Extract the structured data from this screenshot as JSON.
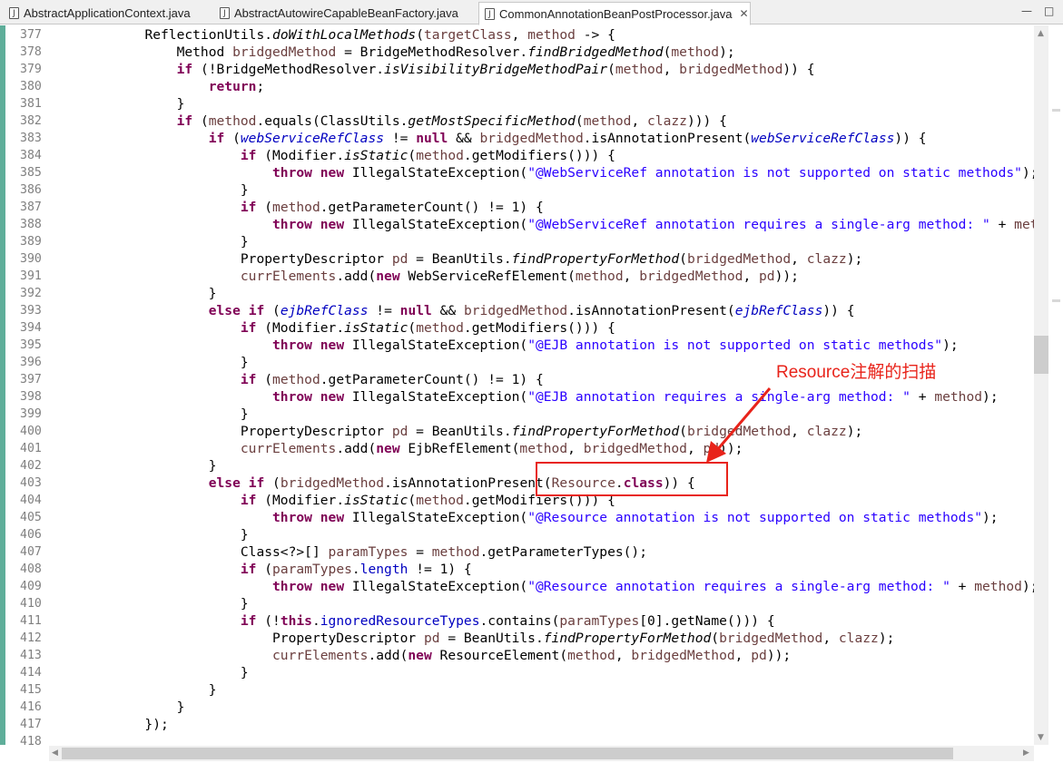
{
  "tabs": [
    {
      "label": "AbstractApplicationContext.java",
      "active": false,
      "icon": "java-file-icon"
    },
    {
      "label": "AbstractAutowireCapableBeanFactory.java",
      "active": false,
      "icon": "java-file-icon"
    },
    {
      "label": "CommonAnnotationBeanPostProcessor.java",
      "active": true,
      "icon": "java-file-icon",
      "close": "✕"
    }
  ],
  "window_controls": {
    "minimize": "—",
    "maximize": "□"
  },
  "annotation": {
    "text": "Resource注解的扫描",
    "color": "#e8231a"
  },
  "colors": {
    "keyword": "#7f0055",
    "field": "#0000c0",
    "string": "#2a00ff",
    "local_var": "#6a3e3e",
    "line_number": "#808080",
    "annotation": "#e8231a"
  },
  "lines": [
    {
      "n": "377",
      "segs": [
        [
          "            ",
          ""
        ],
        [
          "ReflectionUtils.",
          ""
        ],
        [
          "doWithLocalMethods",
          "mi"
        ],
        [
          "(",
          ""
        ],
        [
          "targetClass",
          "var"
        ],
        [
          ", ",
          ""
        ],
        [
          "method",
          "var"
        ],
        [
          " -> {",
          ""
        ]
      ]
    },
    {
      "n": "378",
      "segs": [
        [
          "                Method ",
          ""
        ],
        [
          "bridgedMethod",
          "var"
        ],
        [
          " = BridgeMethodResolver.",
          ""
        ],
        [
          "findBridgedMethod",
          "mi"
        ],
        [
          "(",
          ""
        ],
        [
          "method",
          "var"
        ],
        [
          ");",
          ""
        ]
      ]
    },
    {
      "n": "379",
      "segs": [
        [
          "                ",
          ""
        ],
        [
          "if",
          "kw"
        ],
        [
          " (!BridgeMethodResolver.",
          ""
        ],
        [
          "isVisibilityBridgeMethodPair",
          "mi"
        ],
        [
          "(",
          ""
        ],
        [
          "method",
          "var"
        ],
        [
          ", ",
          ""
        ],
        [
          "bridgedMethod",
          "var"
        ],
        [
          ")) {",
          ""
        ]
      ]
    },
    {
      "n": "380",
      "segs": [
        [
          "                    ",
          ""
        ],
        [
          "return",
          "kw"
        ],
        [
          ";",
          ""
        ]
      ]
    },
    {
      "n": "381",
      "segs": [
        [
          "                }",
          ""
        ]
      ]
    },
    {
      "n": "382",
      "segs": [
        [
          "                ",
          ""
        ],
        [
          "if",
          "kw"
        ],
        [
          " (",
          ""
        ],
        [
          "method",
          "var"
        ],
        [
          ".equals(ClassUtils.",
          ""
        ],
        [
          "getMostSpecificMethod",
          "mi"
        ],
        [
          "(",
          ""
        ],
        [
          "method",
          "var"
        ],
        [
          ", ",
          ""
        ],
        [
          "clazz",
          "var"
        ],
        [
          "))) {",
          ""
        ]
      ]
    },
    {
      "n": "383",
      "segs": [
        [
          "                    ",
          ""
        ],
        [
          "if",
          "kw"
        ],
        [
          " (",
          ""
        ],
        [
          "webServiceRefClass",
          "fldi"
        ],
        [
          " != ",
          ""
        ],
        [
          "null",
          "kw"
        ],
        [
          " && ",
          ""
        ],
        [
          "bridgedMethod",
          "var"
        ],
        [
          ".isAnnotationPresent(",
          ""
        ],
        [
          "webServiceRefClass",
          "fldi"
        ],
        [
          ")) {",
          ""
        ]
      ]
    },
    {
      "n": "384",
      "segs": [
        [
          "                        ",
          ""
        ],
        [
          "if",
          "kw"
        ],
        [
          " (Modifier.",
          ""
        ],
        [
          "isStatic",
          "mi"
        ],
        [
          "(",
          ""
        ],
        [
          "method",
          "var"
        ],
        [
          ".getModifiers())) {",
          ""
        ]
      ]
    },
    {
      "n": "385",
      "segs": [
        [
          "                            ",
          ""
        ],
        [
          "throw",
          "kw"
        ],
        [
          " ",
          ""
        ],
        [
          "new",
          "kw"
        ],
        [
          " IllegalStateException(",
          ""
        ],
        [
          "\"@WebServiceRef annotation is not supported on static methods\"",
          "str"
        ],
        [
          ");",
          ""
        ]
      ]
    },
    {
      "n": "386",
      "segs": [
        [
          "                        }",
          ""
        ]
      ]
    },
    {
      "n": "387",
      "segs": [
        [
          "                        ",
          ""
        ],
        [
          "if",
          "kw"
        ],
        [
          " (",
          ""
        ],
        [
          "method",
          "var"
        ],
        [
          ".getParameterCount() != 1) {",
          ""
        ]
      ]
    },
    {
      "n": "388",
      "segs": [
        [
          "                            ",
          ""
        ],
        [
          "throw",
          "kw"
        ],
        [
          " ",
          ""
        ],
        [
          "new",
          "kw"
        ],
        [
          " IllegalStateException(",
          ""
        ],
        [
          "\"@WebServiceRef annotation requires a single-arg method: \"",
          "str"
        ],
        [
          " + ",
          ""
        ],
        [
          "method",
          "var"
        ],
        [
          ");",
          ""
        ]
      ]
    },
    {
      "n": "389",
      "segs": [
        [
          "                        }",
          ""
        ]
      ]
    },
    {
      "n": "390",
      "segs": [
        [
          "                        PropertyDescriptor ",
          ""
        ],
        [
          "pd",
          "var"
        ],
        [
          " = BeanUtils.",
          ""
        ],
        [
          "findPropertyForMethod",
          "mi"
        ],
        [
          "(",
          ""
        ],
        [
          "bridgedMethod",
          "var"
        ],
        [
          ", ",
          ""
        ],
        [
          "clazz",
          "var"
        ],
        [
          ");",
          ""
        ]
      ]
    },
    {
      "n": "391",
      "segs": [
        [
          "                        ",
          ""
        ],
        [
          "currElements",
          "var"
        ],
        [
          ".add(",
          ""
        ],
        [
          "new",
          "kw"
        ],
        [
          " WebServiceRefElement(",
          ""
        ],
        [
          "method",
          "var"
        ],
        [
          ", ",
          ""
        ],
        [
          "bridgedMethod",
          "var"
        ],
        [
          ", ",
          ""
        ],
        [
          "pd",
          "var"
        ],
        [
          "));",
          ""
        ]
      ]
    },
    {
      "n": "392",
      "segs": [
        [
          "                    }",
          ""
        ]
      ]
    },
    {
      "n": "393",
      "segs": [
        [
          "                    ",
          ""
        ],
        [
          "else",
          "kw"
        ],
        [
          " ",
          ""
        ],
        [
          "if",
          "kw"
        ],
        [
          " (",
          ""
        ],
        [
          "ejbRefClass",
          "fldi"
        ],
        [
          " != ",
          ""
        ],
        [
          "null",
          "kw"
        ],
        [
          " && ",
          ""
        ],
        [
          "bridgedMethod",
          "var"
        ],
        [
          ".isAnnotationPresent(",
          ""
        ],
        [
          "ejbRefClass",
          "fldi"
        ],
        [
          ")) {",
          ""
        ]
      ]
    },
    {
      "n": "394",
      "segs": [
        [
          "                        ",
          ""
        ],
        [
          "if",
          "kw"
        ],
        [
          " (Modifier.",
          ""
        ],
        [
          "isStatic",
          "mi"
        ],
        [
          "(",
          ""
        ],
        [
          "method",
          "var"
        ],
        [
          ".getModifiers())) {",
          ""
        ]
      ]
    },
    {
      "n": "395",
      "segs": [
        [
          "                            ",
          ""
        ],
        [
          "throw",
          "kw"
        ],
        [
          " ",
          ""
        ],
        [
          "new",
          "kw"
        ],
        [
          " IllegalStateException(",
          ""
        ],
        [
          "\"@EJB annotation is not supported on static methods\"",
          "str"
        ],
        [
          ");",
          ""
        ]
      ]
    },
    {
      "n": "396",
      "segs": [
        [
          "                        }",
          ""
        ]
      ]
    },
    {
      "n": "397",
      "segs": [
        [
          "                        ",
          ""
        ],
        [
          "if",
          "kw"
        ],
        [
          " (",
          ""
        ],
        [
          "method",
          "var"
        ],
        [
          ".getParameterCount() != 1) {",
          ""
        ]
      ]
    },
    {
      "n": "398",
      "segs": [
        [
          "                            ",
          ""
        ],
        [
          "throw",
          "kw"
        ],
        [
          " ",
          ""
        ],
        [
          "new",
          "kw"
        ],
        [
          " IllegalStateException(",
          ""
        ],
        [
          "\"@EJB annotation requires a single-arg method: \"",
          "str"
        ],
        [
          " + ",
          ""
        ],
        [
          "method",
          "var"
        ],
        [
          ");",
          ""
        ]
      ]
    },
    {
      "n": "399",
      "segs": [
        [
          "                        }",
          ""
        ]
      ]
    },
    {
      "n": "400",
      "segs": [
        [
          "                        PropertyDescriptor ",
          ""
        ],
        [
          "pd",
          "var"
        ],
        [
          " = BeanUtils.",
          ""
        ],
        [
          "findPropertyForMethod",
          "mi"
        ],
        [
          "(",
          ""
        ],
        [
          "bridgedMethod",
          "var"
        ],
        [
          ", ",
          ""
        ],
        [
          "clazz",
          "var"
        ],
        [
          ");",
          ""
        ]
      ]
    },
    {
      "n": "401",
      "segs": [
        [
          "                        ",
          ""
        ],
        [
          "currElements",
          "var"
        ],
        [
          ".add(",
          ""
        ],
        [
          "new",
          "kw"
        ],
        [
          " EjbRefElement(",
          ""
        ],
        [
          "method",
          "var"
        ],
        [
          ", ",
          ""
        ],
        [
          "bridgedMethod",
          "var"
        ],
        [
          ", ",
          ""
        ],
        [
          "pd",
          "var"
        ],
        [
          "));",
          ""
        ]
      ]
    },
    {
      "n": "402",
      "segs": [
        [
          "                    }",
          ""
        ]
      ]
    },
    {
      "n": "403",
      "segs": [
        [
          "                    ",
          ""
        ],
        [
          "else",
          "kw"
        ],
        [
          " ",
          ""
        ],
        [
          "if",
          "kw"
        ],
        [
          " (",
          ""
        ],
        [
          "bridgedMethod",
          "var"
        ],
        [
          ".isAnnotationPresent(",
          ""
        ],
        [
          "Resource",
          "var"
        ],
        [
          ".",
          ""
        ],
        [
          "class",
          "kw"
        ],
        [
          ")) {",
          ""
        ]
      ]
    },
    {
      "n": "404",
      "segs": [
        [
          "                        ",
          ""
        ],
        [
          "if",
          "kw"
        ],
        [
          " (Modifier.",
          ""
        ],
        [
          "isStatic",
          "mi"
        ],
        [
          "(",
          ""
        ],
        [
          "method",
          "var"
        ],
        [
          ".getModifiers())) {",
          ""
        ]
      ]
    },
    {
      "n": "405",
      "segs": [
        [
          "                            ",
          ""
        ],
        [
          "throw",
          "kw"
        ],
        [
          " ",
          ""
        ],
        [
          "new",
          "kw"
        ],
        [
          " IllegalStateException(",
          ""
        ],
        [
          "\"@Resource annotation is not supported on static methods\"",
          "str"
        ],
        [
          ");",
          ""
        ]
      ]
    },
    {
      "n": "406",
      "segs": [
        [
          "                        }",
          ""
        ]
      ]
    },
    {
      "n": "407",
      "segs": [
        [
          "                        Class<?>[] ",
          ""
        ],
        [
          "paramTypes",
          "var"
        ],
        [
          " = ",
          ""
        ],
        [
          "method",
          "var"
        ],
        [
          ".getParameterTypes();",
          ""
        ]
      ]
    },
    {
      "n": "408",
      "segs": [
        [
          "                        ",
          ""
        ],
        [
          "if",
          "kw"
        ],
        [
          " (",
          ""
        ],
        [
          "paramTypes",
          "var"
        ],
        [
          ".",
          ""
        ],
        [
          "length",
          "fld"
        ],
        [
          " != 1) {",
          ""
        ]
      ]
    },
    {
      "n": "409",
      "segs": [
        [
          "                            ",
          ""
        ],
        [
          "throw",
          "kw"
        ],
        [
          " ",
          ""
        ],
        [
          "new",
          "kw"
        ],
        [
          " IllegalStateException(",
          ""
        ],
        [
          "\"@Resource annotation requires a single-arg method: \"",
          "str"
        ],
        [
          " + ",
          ""
        ],
        [
          "method",
          "var"
        ],
        [
          ");",
          ""
        ]
      ]
    },
    {
      "n": "410",
      "segs": [
        [
          "                        }",
          ""
        ]
      ]
    },
    {
      "n": "411",
      "segs": [
        [
          "                        ",
          ""
        ],
        [
          "if",
          "kw"
        ],
        [
          " (!",
          ""
        ],
        [
          "this",
          "kw"
        ],
        [
          ".",
          ""
        ],
        [
          "ignoredResourceTypes",
          "fld"
        ],
        [
          ".contains(",
          ""
        ],
        [
          "paramTypes",
          "var"
        ],
        [
          "[0].getName())) {",
          ""
        ]
      ]
    },
    {
      "n": "412",
      "segs": [
        [
          "                            PropertyDescriptor ",
          ""
        ],
        [
          "pd",
          "var"
        ],
        [
          " = BeanUtils.",
          ""
        ],
        [
          "findPropertyForMethod",
          "mi"
        ],
        [
          "(",
          ""
        ],
        [
          "bridgedMethod",
          "var"
        ],
        [
          ", ",
          ""
        ],
        [
          "clazz",
          "var"
        ],
        [
          ");",
          ""
        ]
      ]
    },
    {
      "n": "413",
      "segs": [
        [
          "                            ",
          ""
        ],
        [
          "currElements",
          "var"
        ],
        [
          ".add(",
          ""
        ],
        [
          "new",
          "kw"
        ],
        [
          " ResourceElement(",
          ""
        ],
        [
          "method",
          "var"
        ],
        [
          ", ",
          ""
        ],
        [
          "bridgedMethod",
          "var"
        ],
        [
          ", ",
          ""
        ],
        [
          "pd",
          "var"
        ],
        [
          "));",
          ""
        ]
      ]
    },
    {
      "n": "414",
      "segs": [
        [
          "                        }",
          ""
        ]
      ]
    },
    {
      "n": "415",
      "segs": [
        [
          "                    }",
          ""
        ]
      ]
    },
    {
      "n": "416",
      "segs": [
        [
          "                }",
          ""
        ]
      ]
    },
    {
      "n": "417",
      "segs": [
        [
          "            });",
          ""
        ]
      ]
    },
    {
      "n": "418",
      "segs": [
        [
          "",
          ""
        ]
      ]
    }
  ]
}
